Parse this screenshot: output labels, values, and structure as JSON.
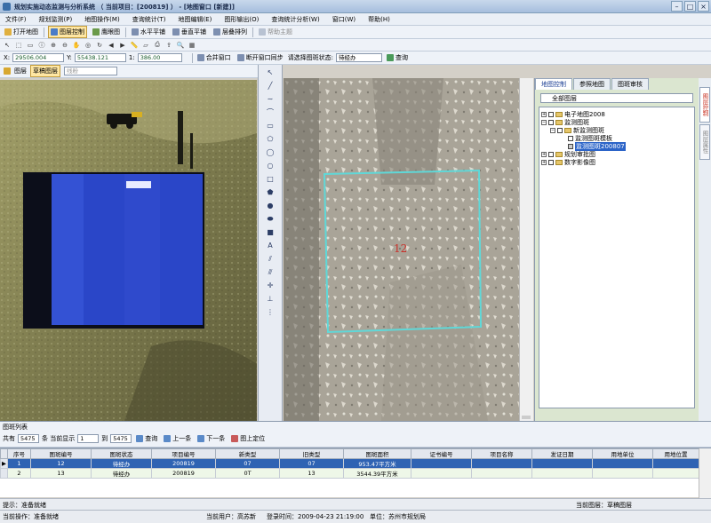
{
  "window": {
    "title": "规划实施动态监测与分析系统 （ 当前项目：[200819] ） - [地图窗口 [新建]]"
  },
  "menu": [
    "文件(F)",
    "规划监测(P)",
    "地图操作(M)",
    "查询统计(T)",
    "地图编辑(E)",
    "图形输出(O)",
    "查询统计分析(W)",
    "窗口(W)",
    "帮助(H)"
  ],
  "toolbar1": {
    "open_map": "打开地图",
    "layer_control": "图层控制",
    "eagle_eye": "鹰眼图",
    "horizontal_tile": "水平平铺",
    "vertical_tile": "垂直平铺",
    "cascade": "层叠排列",
    "help_topic": "帮助主题"
  },
  "coords": {
    "x_label": "X:",
    "x_value": "29506.004",
    "y_label": "Y:",
    "y_value": "55438.121",
    "scale_label": "1:",
    "scale_value": "386.00",
    "merge_window": "合并窗口",
    "disconnect_sync": "断开窗口同步",
    "status_prompt": "请选择图斑状态:",
    "status_value": "待经办",
    "query": "查询"
  },
  "layerbar": {
    "layer": "图层",
    "draft_layer": "草稿图层",
    "dropdown": "线粉"
  },
  "map": {
    "polygon_label": "12"
  },
  "panel": {
    "tabs": [
      "地图控制",
      "参照地图",
      "图斑审核"
    ],
    "combo": "全部图层",
    "tree": [
      "电子地图2008",
      "监测图斑",
      "新监测图斑",
      "监测图斑模板",
      "监测图斑200807",
      "规划审批图",
      "数字影像图"
    ],
    "vtabs": [
      "图层控制",
      "图层属性"
    ]
  },
  "list": {
    "title": "图斑列表",
    "total_label": "共有",
    "total_value": "5475",
    "page_label": "条 当前显示",
    "page_from": "1",
    "to_label": "到",
    "page_to": "5475",
    "btn_query": "查询",
    "btn_prev": "上一条",
    "btn_next": "下一条",
    "btn_locate": "图上定位"
  },
  "grid": {
    "headers": [
      "序号",
      "图斑编号",
      "图斑状态",
      "项目编号",
      "新类型",
      "旧类型",
      "图斑面积",
      "证书编号",
      "项目名称",
      "发证日期",
      "用地单位",
      "用地位置"
    ],
    "rows": [
      [
        "1",
        "12",
        "待经办",
        "200819",
        "07",
        "07",
        "953.47平方米",
        "",
        "",
        "",
        "",
        ""
      ],
      [
        "2",
        "13",
        "待经办",
        "200819",
        "0T",
        "13",
        "3544.39平方米",
        "",
        "",
        "",
        "",
        ""
      ]
    ]
  },
  "status": {
    "hint": "提示：准备就绪",
    "current_layer": "当前图层：草稿图层",
    "current_op": "当前操作：准备就绪",
    "current_user": "当前用户：高苏新",
    "login_time": "登录时间：2009-04-23 21:19:00",
    "unit": "单位：苏州市规划局"
  },
  "colors": {
    "accent": "#2f63b3",
    "polygon": "#5fd8d8",
    "label": "#c8302a",
    "selection": "#2c64c8",
    "roof": "#2a46c8"
  }
}
